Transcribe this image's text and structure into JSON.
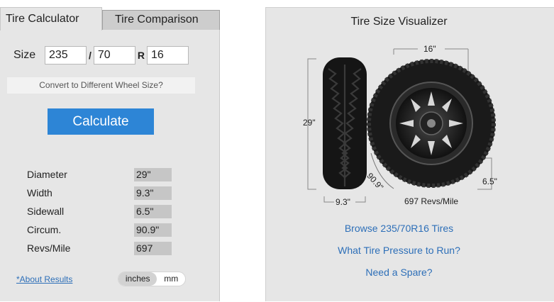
{
  "tabs": {
    "calculator": "Tire Calculator",
    "comparison": "Tire Comparison"
  },
  "size": {
    "label": "Size",
    "width": "235",
    "sep1": "/",
    "ratio": "70",
    "sep2": "R",
    "rim": "16"
  },
  "convert_label": "Convert to Different Wheel Size?",
  "calculate_label": "Calculate",
  "results": [
    {
      "label": "Diameter",
      "value": "29\""
    },
    {
      "label": "Width",
      "value": "9.3\""
    },
    {
      "label": "Sidewall",
      "value": "6.5\""
    },
    {
      "label": "Circum.",
      "value": "90.9\""
    },
    {
      "label": "Revs/Mile",
      "value": "697"
    }
  ],
  "about_label": "*About Results",
  "units": {
    "inches": "inches",
    "mm": "mm"
  },
  "visualizer": {
    "title": "Tire Size Visualizer",
    "diameter": "29\"",
    "rim": "16\"",
    "width": "9.3\"",
    "sidewall": "6.5\"",
    "circumference": "90.9\"",
    "revs": "697 Revs/Mile"
  },
  "links": {
    "browse": "Browse 235/70R16 Tires",
    "pressure": "What Tire Pressure to Run?",
    "spare": "Need a Spare?"
  }
}
